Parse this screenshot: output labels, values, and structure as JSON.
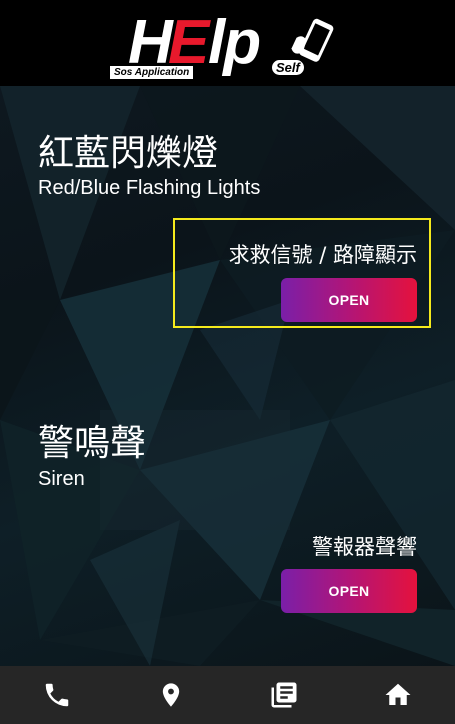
{
  "logo": {
    "letter_h": "H",
    "letter_e": "E",
    "letters_lp": "lp",
    "subtitle": "Sos  Application",
    "self": "Self"
  },
  "sections": [
    {
      "title_cn": "紅藍閃爍燈",
      "title_en": "Red/Blue Flashing Lights",
      "action_label": "求救信號 / 路障顯示",
      "button_label": "OPEN"
    },
    {
      "title_cn": "警鳴聲",
      "title_en": "Siren",
      "action_label": "警報器聲響",
      "button_label": "OPEN"
    }
  ],
  "bottom_nav": [
    {
      "icon": "phone-icon"
    },
    {
      "icon": "location-pin-icon"
    },
    {
      "icon": "library-books-icon"
    },
    {
      "icon": "home-icon"
    }
  ],
  "colors": {
    "highlight": "#f5ea1c",
    "button_gradient_start": "#7a1fa8",
    "button_gradient_end": "#e5123d",
    "logo_red": "#e8192c",
    "nav_background": "#262626"
  }
}
